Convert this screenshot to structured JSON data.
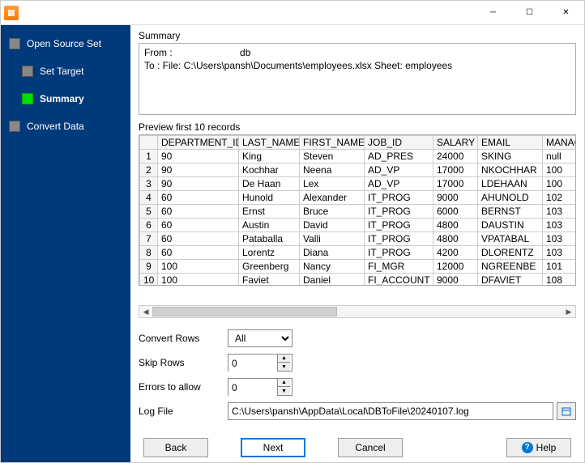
{
  "sidebar": {
    "steps": [
      {
        "label": "Open Source Set",
        "active": false,
        "indent": false
      },
      {
        "label": "Set Target",
        "active": false,
        "indent": true
      },
      {
        "label": "Summary",
        "active": true,
        "indent": true
      },
      {
        "label": "Convert Data",
        "active": false,
        "indent": false
      }
    ]
  },
  "summary": {
    "title": "Summary",
    "from_label": "From :",
    "from_value": "db",
    "to_line": "To : File: C:\\Users\\pansh\\Documents\\employees.xlsx Sheet: employees"
  },
  "preview": {
    "title": "Preview first 10 records",
    "columns": [
      "DEPARTMENT_ID",
      "LAST_NAME",
      "FIRST_NAME",
      "JOB_ID",
      "SALARY",
      "EMAIL",
      "MANAG"
    ],
    "rows": [
      {
        "n": "1",
        "DEPARTMENT_ID": "90",
        "LAST_NAME": "King",
        "FIRST_NAME": "Steven",
        "JOB_ID": "AD_PRES",
        "SALARY": "24000",
        "EMAIL": "SKING",
        "MANAG": "null"
      },
      {
        "n": "2",
        "DEPARTMENT_ID": "90",
        "LAST_NAME": "Kochhar",
        "FIRST_NAME": "Neena",
        "JOB_ID": "AD_VP",
        "SALARY": "17000",
        "EMAIL": "NKOCHHAR",
        "MANAG": "100"
      },
      {
        "n": "3",
        "DEPARTMENT_ID": "90",
        "LAST_NAME": "De Haan",
        "FIRST_NAME": "Lex",
        "JOB_ID": "AD_VP",
        "SALARY": "17000",
        "EMAIL": "LDEHAAN",
        "MANAG": "100"
      },
      {
        "n": "4",
        "DEPARTMENT_ID": "60",
        "LAST_NAME": "Hunold",
        "FIRST_NAME": "Alexander",
        "JOB_ID": "IT_PROG",
        "SALARY": "9000",
        "EMAIL": "AHUNOLD",
        "MANAG": "102"
      },
      {
        "n": "5",
        "DEPARTMENT_ID": "60",
        "LAST_NAME": "Ernst",
        "FIRST_NAME": "Bruce",
        "JOB_ID": "IT_PROG",
        "SALARY": "6000",
        "EMAIL": "BERNST",
        "MANAG": "103"
      },
      {
        "n": "6",
        "DEPARTMENT_ID": "60",
        "LAST_NAME": "Austin",
        "FIRST_NAME": "David",
        "JOB_ID": "IT_PROG",
        "SALARY": "4800",
        "EMAIL": "DAUSTIN",
        "MANAG": "103"
      },
      {
        "n": "7",
        "DEPARTMENT_ID": "60",
        "LAST_NAME": "Pataballa",
        "FIRST_NAME": "Valli",
        "JOB_ID": "IT_PROG",
        "SALARY": "4800",
        "EMAIL": "VPATABAL",
        "MANAG": "103"
      },
      {
        "n": "8",
        "DEPARTMENT_ID": "60",
        "LAST_NAME": "Lorentz",
        "FIRST_NAME": "Diana",
        "JOB_ID": "IT_PROG",
        "SALARY": "4200",
        "EMAIL": "DLORENTZ",
        "MANAG": "103"
      },
      {
        "n": "9",
        "DEPARTMENT_ID": "100",
        "LAST_NAME": "Greenberg",
        "FIRST_NAME": "Nancy",
        "JOB_ID": "FI_MGR",
        "SALARY": "12000",
        "EMAIL": "NGREENBE",
        "MANAG": "101"
      },
      {
        "n": "10",
        "DEPARTMENT_ID": "100",
        "LAST_NAME": "Faviet",
        "FIRST_NAME": "Daniel",
        "JOB_ID": "FI_ACCOUNT",
        "SALARY": "9000",
        "EMAIL": "DFAVIET",
        "MANAG": "108"
      }
    ]
  },
  "form": {
    "convert_rows_label": "Convert Rows",
    "convert_rows_value": "All",
    "skip_rows_label": "Skip Rows",
    "skip_rows_value": "0",
    "errors_label": "Errors to allow",
    "errors_value": "0",
    "log_file_label": "Log File",
    "log_file_value": "C:\\Users\\pansh\\AppData\\Local\\DBToFile\\20240107.log"
  },
  "buttons": {
    "back": "Back",
    "next": "Next",
    "cancel": "Cancel",
    "help": "Help"
  }
}
